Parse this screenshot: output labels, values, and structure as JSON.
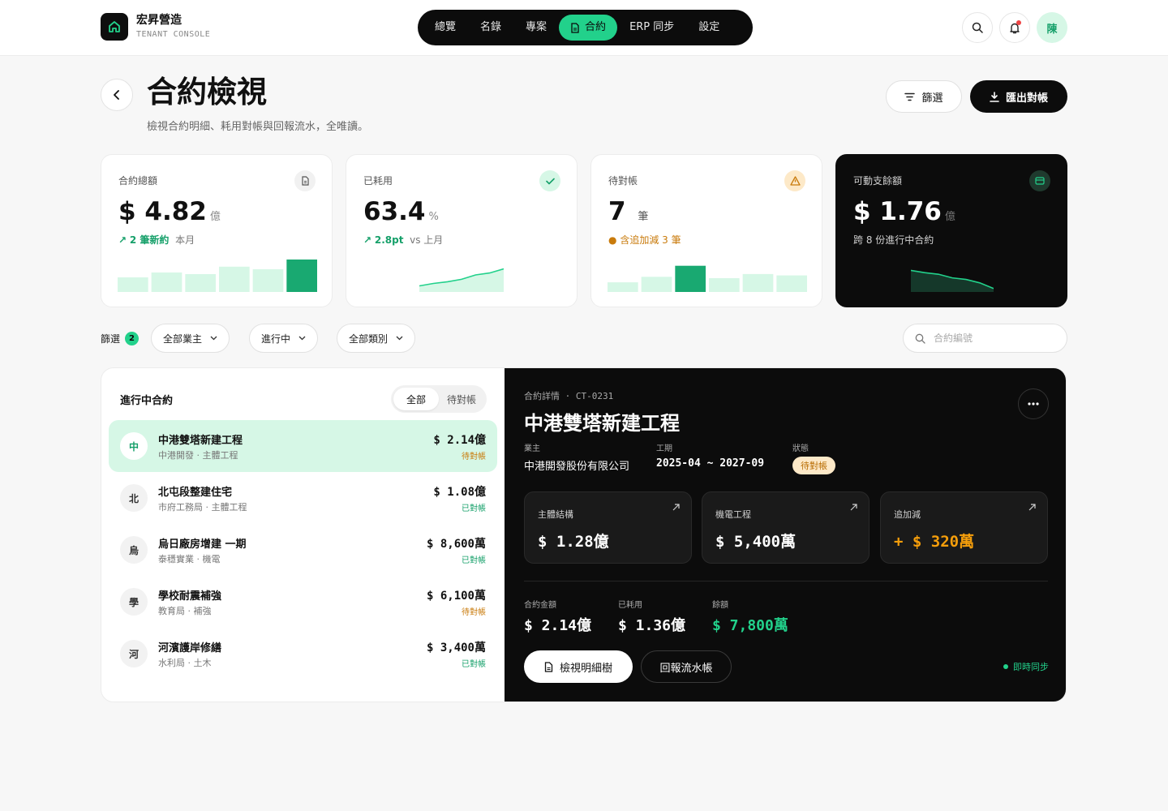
{
  "brand": {
    "name": "宏昇營造",
    "sub": "TENANT CONSOLE"
  },
  "nav": [
    {
      "label": "總覽",
      "active": false
    },
    {
      "label": "名錄",
      "active": false
    },
    {
      "label": "專案",
      "active": false
    },
    {
      "label": "合約",
      "active": true
    },
    {
      "label": "ERP 同步",
      "active": false
    },
    {
      "label": "設定",
      "active": false
    }
  ],
  "user": {
    "avatar_initial": "陳"
  },
  "header": {
    "title": "合約檢視",
    "subtitle": "檢視合約明細、耗用對帳與回報流水，全唯讀。",
    "filter_btn": "篩選",
    "export_btn": "匯出對帳"
  },
  "kpis": [
    {
      "label": "合約總額",
      "prefix": "$ ",
      "value": "4.82",
      "unit": "億",
      "delta": "2 筆新約",
      "delta_suffix": "本月",
      "icon": "document-icon",
      "bars": [
        0.45,
        0.6,
        0.55,
        0.78,
        0.7,
        1.0
      ],
      "highlight": 5
    },
    {
      "label": "已耗用",
      "prefix": "",
      "value": "63.4",
      "unit": "%",
      "delta": "2.8pt",
      "delta_suffix": "vs 上月",
      "icon": "check-icon",
      "line": [
        0.25,
        0.35,
        0.42,
        0.52,
        0.7,
        0.78,
        0.95
      ]
    },
    {
      "label": "待對帳",
      "prefix": "",
      "value": "7",
      "unit": "筆",
      "note": "含追加減 3 筆",
      "icon": "warning-icon",
      "bars": [
        0.35,
        0.55,
        0.95,
        0.5,
        0.65,
        0.6
      ],
      "highlight": 2
    },
    {
      "label": "可動支餘額",
      "prefix": "$ ",
      "value": "1.76",
      "unit": "億",
      "note": "跨 8 份進行中合約",
      "icon": "wallet-icon",
      "line": [
        0.95,
        0.85,
        0.78,
        0.62,
        0.55,
        0.4,
        0.15
      ]
    }
  ],
  "filters": {
    "label": "篩選",
    "count": "2",
    "owner": "全部業主",
    "status": "進行中",
    "category": "全部類別",
    "search_placeholder": "合約編號"
  },
  "list": {
    "title": "進行中合約",
    "tabs": [
      "全部",
      "待對帳"
    ],
    "items": [
      {
        "initial": "中",
        "name": "中港雙塔新建工程",
        "meta": "中港開發 · 主體工程",
        "amount": "$ 2.14億",
        "status": "待對帳",
        "state": "pending",
        "active": true
      },
      {
        "initial": "北",
        "name": "北屯段整建住宅",
        "meta": "市府工務局 · 主體工程",
        "amount": "$ 1.08億",
        "status": "已對帳",
        "state": "done"
      },
      {
        "initial": "烏",
        "name": "烏日廠房增建 一期",
        "meta": "泰穩實業 · 機電",
        "amount": "$ 8,600萬",
        "status": "已對帳",
        "state": "done"
      },
      {
        "initial": "學",
        "name": "學校耐震補強",
        "meta": "教育局 · 補強",
        "amount": "$ 6,100萬",
        "status": "待對帳",
        "state": "pending"
      },
      {
        "initial": "河",
        "name": "河濱護岸修繕",
        "meta": "水利局 · 土木",
        "amount": "$ 3,400萬",
        "status": "已對帳",
        "state": "done"
      }
    ]
  },
  "detail": {
    "crumb": "合約詳情 · CT-0231",
    "title": "中港雙塔新建工程",
    "owner_label": "業主",
    "owner": "中港開發股份有限公司",
    "period_label": "工期",
    "period": "2025-04 ~ 2027-09",
    "status_label": "狀態",
    "status": "待對帳",
    "cards": [
      {
        "label": "主體結構",
        "value": "$ 1.28億"
      },
      {
        "label": "機電工程",
        "value": "$ 5,400萬"
      },
      {
        "label": "追加減",
        "value": "+ $ 320萬"
      }
    ],
    "summary": [
      {
        "label": "合約金額",
        "value": "$ 2.14億"
      },
      {
        "label": "已耗用",
        "value": "$ 1.36億"
      },
      {
        "label": "餘額",
        "value": "$ 7,800萬"
      }
    ],
    "btn_tree": "檢視明細樹",
    "btn_ledger": "回報流水帳",
    "sync": "即時同步"
  },
  "colors": {
    "accent": "#22d18b",
    "accent_light": "#d6f7e6",
    "warn": "#c97b0c",
    "dark": "#0c0c0c"
  }
}
